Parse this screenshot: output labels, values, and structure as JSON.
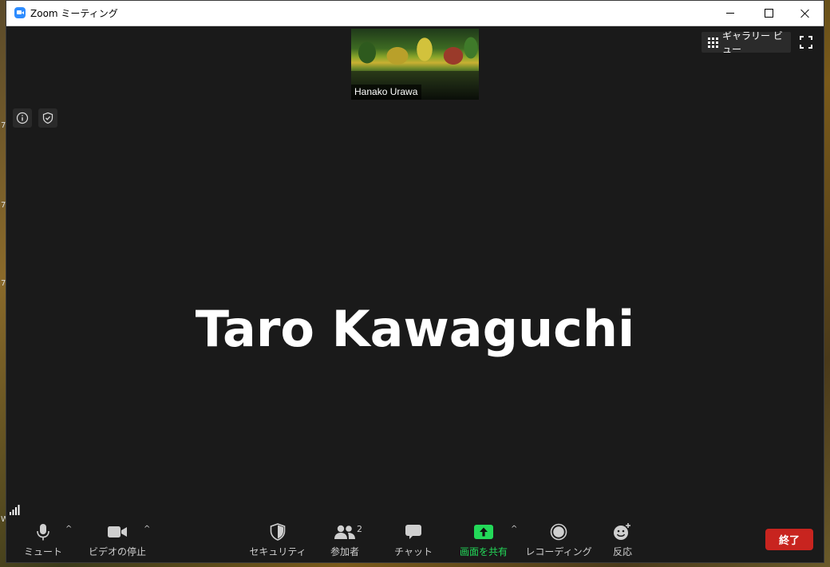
{
  "window": {
    "title": "Zoom ミーティング"
  },
  "thumbnail": {
    "participant_name": "Hanako Urawa"
  },
  "top_bar": {
    "gallery_view_label": "ギャラリー ビュー"
  },
  "main": {
    "active_speaker_name": "Taro Kawaguchi"
  },
  "toolbar": {
    "mute_label": "ミュート",
    "stop_video_label": "ビデオの停止",
    "security_label": "セキュリティ",
    "participants_label": "参加者",
    "participants_count": "2",
    "chat_label": "チャット",
    "share_screen_label": "画面を共有",
    "record_label": "レコーディング",
    "reactions_label": "反応",
    "end_label": "終了"
  },
  "colors": {
    "background": "#1a1a1a",
    "share_green": "#23d959",
    "end_red": "#c8241f",
    "zoom_blue": "#2d8cff"
  },
  "icons": [
    "zoom-app-icon",
    "grid-icon",
    "fullscreen-icon",
    "info-icon",
    "shield-icon",
    "signal-icon",
    "microphone-icon",
    "video-camera-icon",
    "security-shield-icon",
    "participants-icon",
    "chat-icon",
    "share-screen-icon",
    "record-icon",
    "reaction-icon"
  ]
}
